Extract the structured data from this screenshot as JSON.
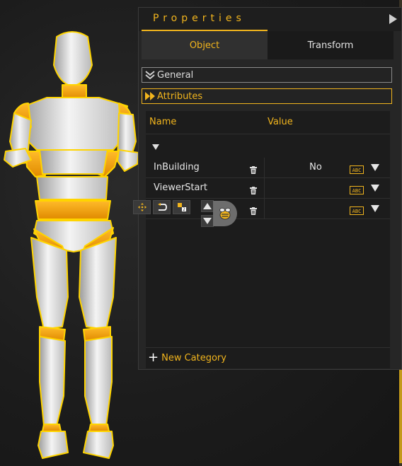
{
  "panel": {
    "title": "Properties",
    "tabs": [
      {
        "label": "Object",
        "active": true
      },
      {
        "label": "Transform",
        "active": false
      }
    ],
    "sections": {
      "general": "General",
      "attributes": "Attributes"
    }
  },
  "table": {
    "headers": {
      "name": "Name",
      "value": "Value"
    },
    "rows": [
      {
        "name": "InBuilding",
        "value": "No"
      },
      {
        "name": "ViewerStart",
        "value": ""
      },
      {
        "name": "",
        "value": ""
      }
    ],
    "new_category": "New Category"
  },
  "colors": {
    "accent": "#f2b51d",
    "panel_bg": "#262626",
    "table_bg": "#1c1c1c",
    "scene_bg": "#1c1c1c"
  },
  "icons": {
    "collapse": "triangle-right-icon",
    "general_section": "double-chevron-down-icon",
    "attributes_section": "double-chevron-right-icon",
    "row_delete": "trash-icon",
    "row_type": "abc-type-icon",
    "row_dropdown": "triangle-down-icon",
    "move": "move-arrows-icon",
    "undo": "undo-arrow-icon",
    "sort": "sort-icon",
    "up": "triangle-up-icon",
    "down": "triangle-down-icon",
    "bee": "bee-icon"
  }
}
